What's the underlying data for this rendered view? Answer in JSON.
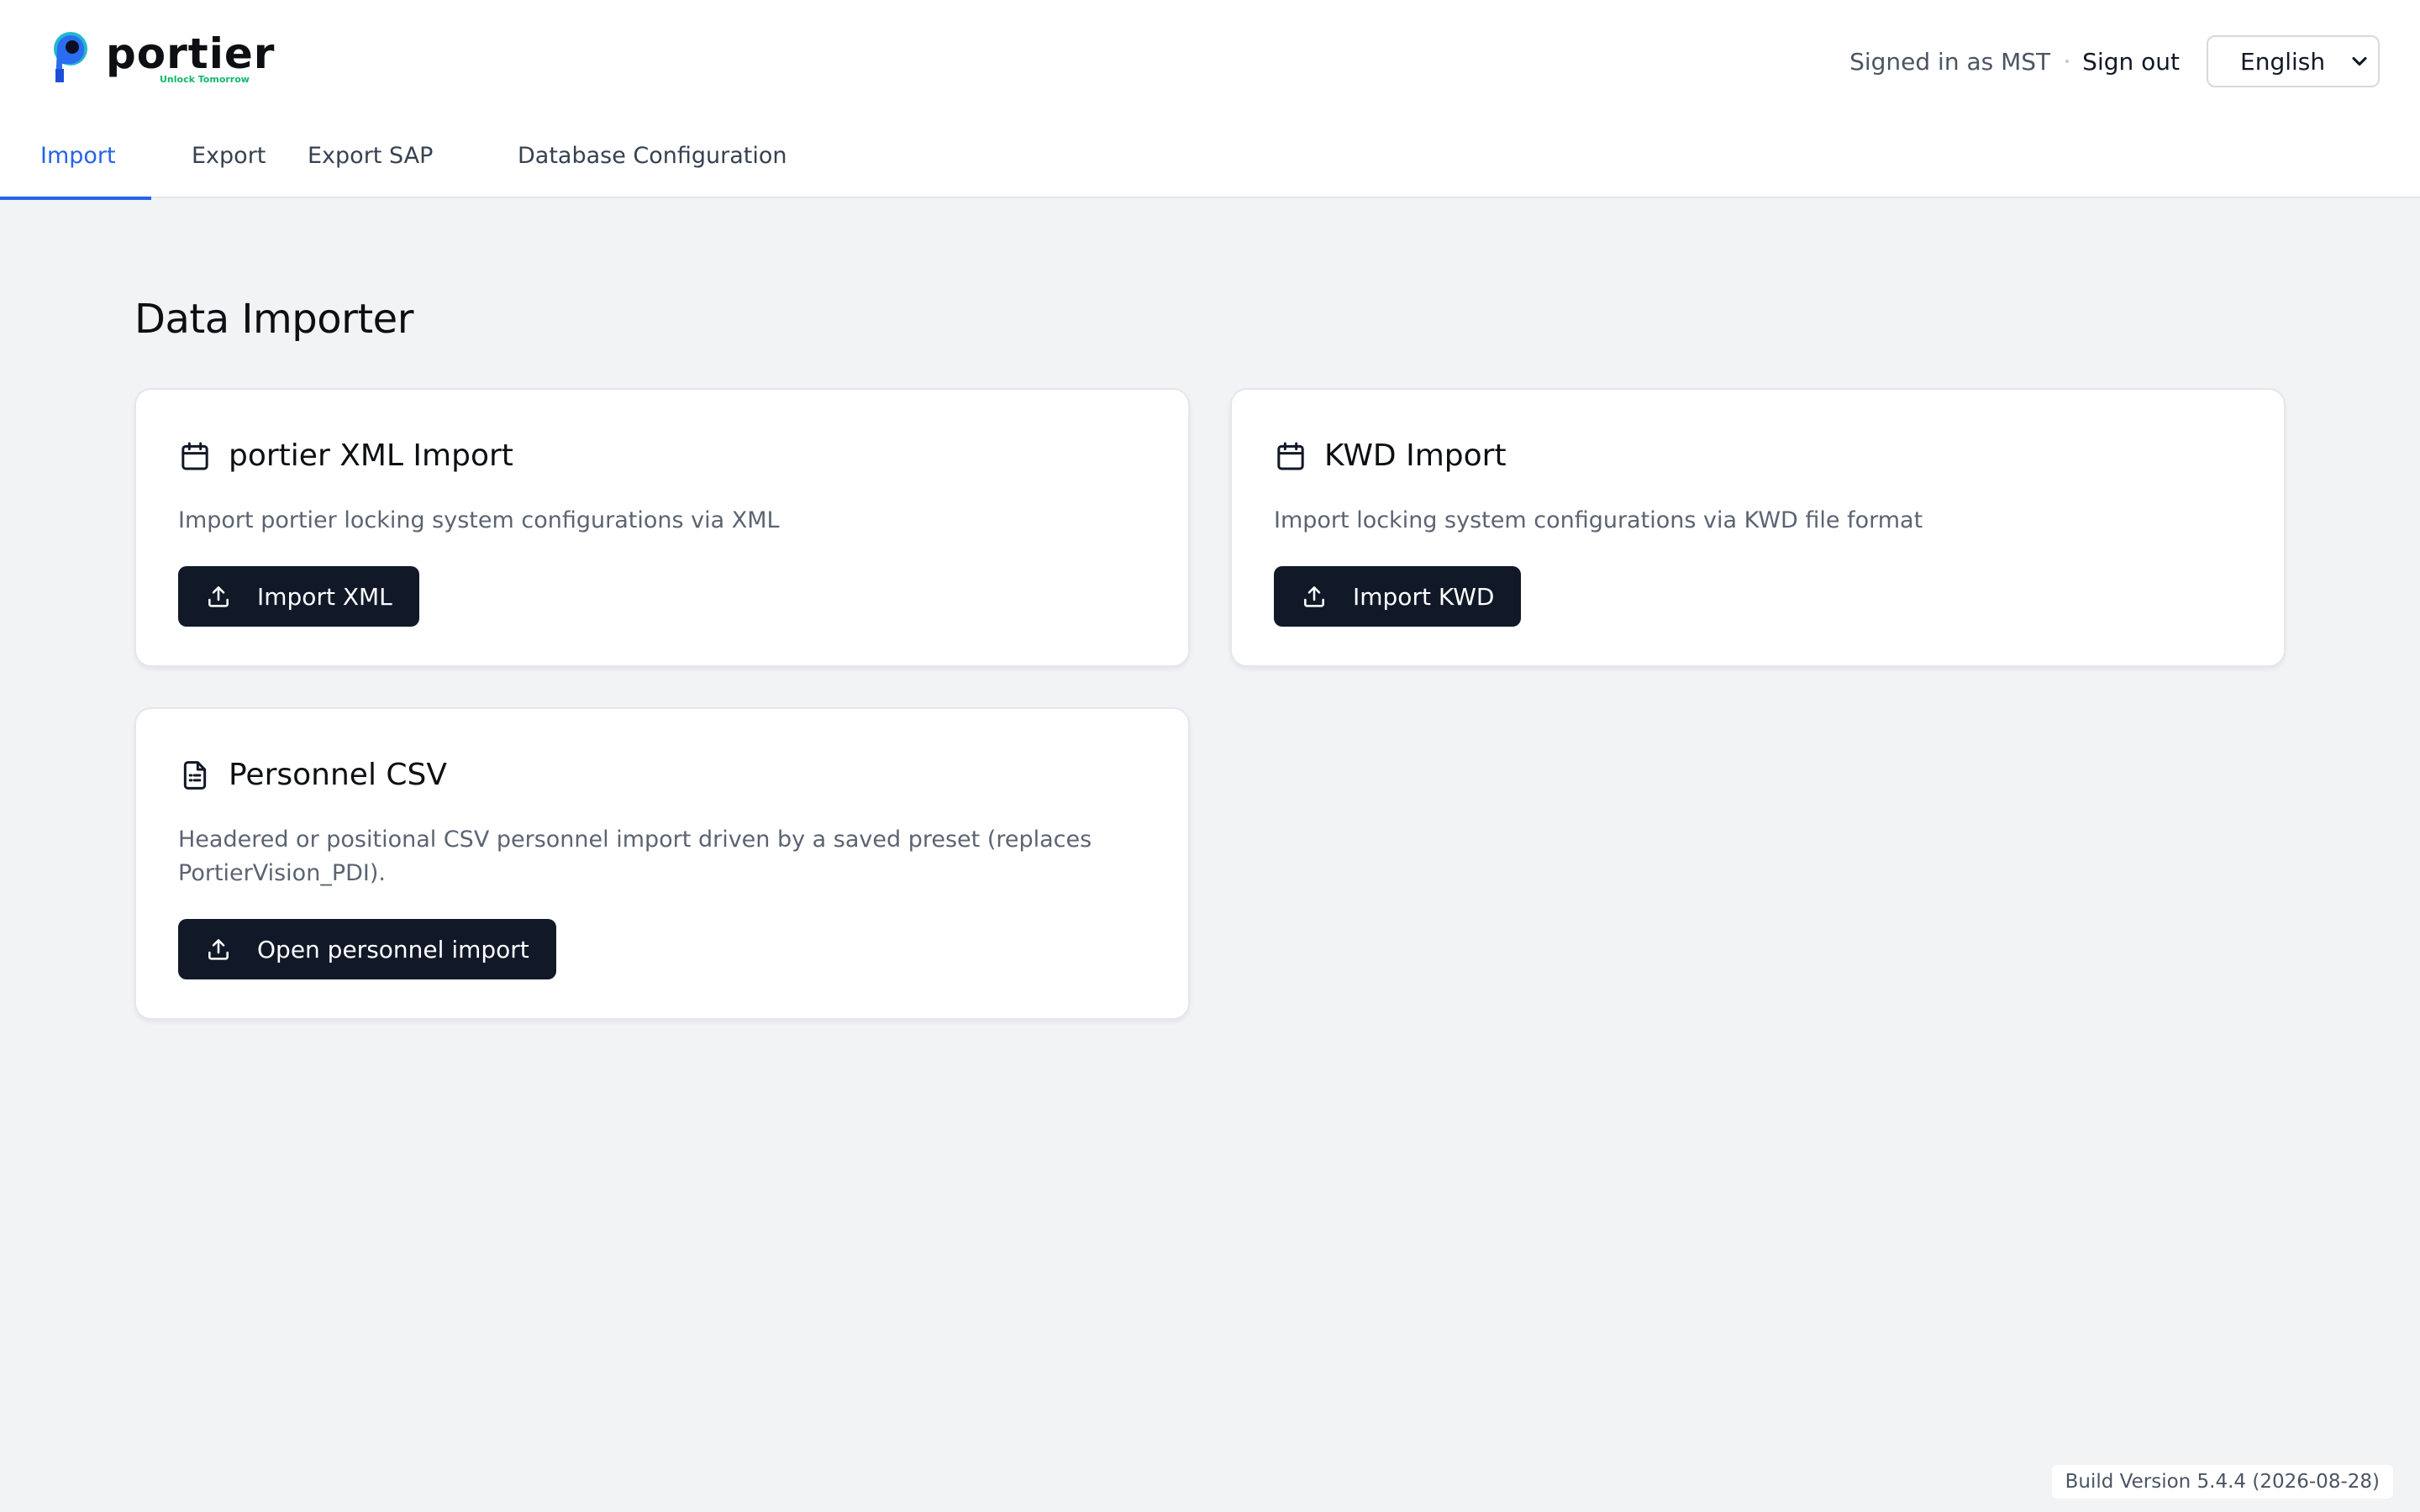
{
  "header": {
    "logo_text": "portier",
    "logo_tagline": "Unlock Tomorrow",
    "signed_in_text": "Signed in as MST",
    "sign_out_label": "Sign out",
    "language": "English"
  },
  "tabs": [
    {
      "label": "Import",
      "active": true
    },
    {
      "label": "Export",
      "active": false
    },
    {
      "label": "Export SAP",
      "active": false
    },
    {
      "label": "Database Configuration",
      "active": false
    }
  ],
  "page": {
    "title": "Data Importer"
  },
  "cards": [
    {
      "icon": "calendar-icon",
      "title": "portier XML Import",
      "description": "Import portier locking system configurations via XML",
      "button": "Import XML",
      "button_icon": "upload-icon"
    },
    {
      "icon": "calendar-icon",
      "title": "KWD Import",
      "description": "Import locking system configurations via KWD file format",
      "button": "Import KWD",
      "button_icon": "upload-icon"
    },
    {
      "icon": "file-text-icon",
      "title": "Personnel CSV",
      "description_lines": [
        "Headered or positional CSV personnel import driven by a saved preset (replaces",
        "PortierVision_PDI)."
      ],
      "button": "Open personnel import",
      "button_icon": "upload-icon"
    }
  ],
  "footer": {
    "build_version": "Build Version 5.4.4 (2026-08-28)"
  },
  "colors": {
    "accent": "#2563eb",
    "button_bg": "#111827",
    "page_bg": "#f2f3f5",
    "logo_green": "#12b76a",
    "logo_blue": "#1d4ed8"
  }
}
